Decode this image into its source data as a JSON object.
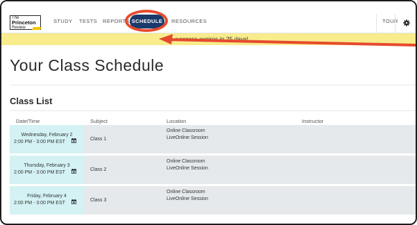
{
  "logo": {
    "line1": "The",
    "line2": "Princeton",
    "line3": "Review"
  },
  "nav": {
    "items": [
      {
        "label": "STUDY"
      },
      {
        "label": "TESTS"
      },
      {
        "label": "REPORTS"
      },
      {
        "label": "SCHEDULE",
        "active": true
      },
      {
        "label": "RESOURCES"
      }
    ],
    "tour": "TOUR",
    "settings_icon": "gear-icon"
  },
  "banner": {
    "text": "r access expires in 25 days!"
  },
  "page": {
    "title": "Your Class Schedule"
  },
  "class_list": {
    "title": "Class List",
    "columns": [
      "Date/Time",
      "Subject",
      "Location",
      "Instructor"
    ],
    "rows": [
      {
        "date": "Wednesday, February 2",
        "time": "2:00 PM - 3:00 PM EST",
        "subject": "Class 1",
        "location1": "Online Classroom",
        "location2": "LiveOnline Session",
        "instructor": ""
      },
      {
        "date": "Thursday, February 3",
        "time": "2:00 PM - 3:00 PM EST",
        "subject": "Class 2",
        "location1": "Online Classroom",
        "location2": "LiveOnline Session",
        "instructor": ""
      },
      {
        "date": "Friday, February 4",
        "time": "2:00 PM - 3:00 PM EST",
        "subject": "Class 3",
        "location1": "Online Classroom",
        "location2": "LiveOnline Session",
        "instructor": ""
      }
    ]
  },
  "colors": {
    "nav_active_bg": "#1b3a6b",
    "banner_bg": "#f8ec8c",
    "highlight_annotation": "#e64a2e",
    "date_cell_bg": "#d4f2f3",
    "row_bg": "#e5e9ec"
  }
}
